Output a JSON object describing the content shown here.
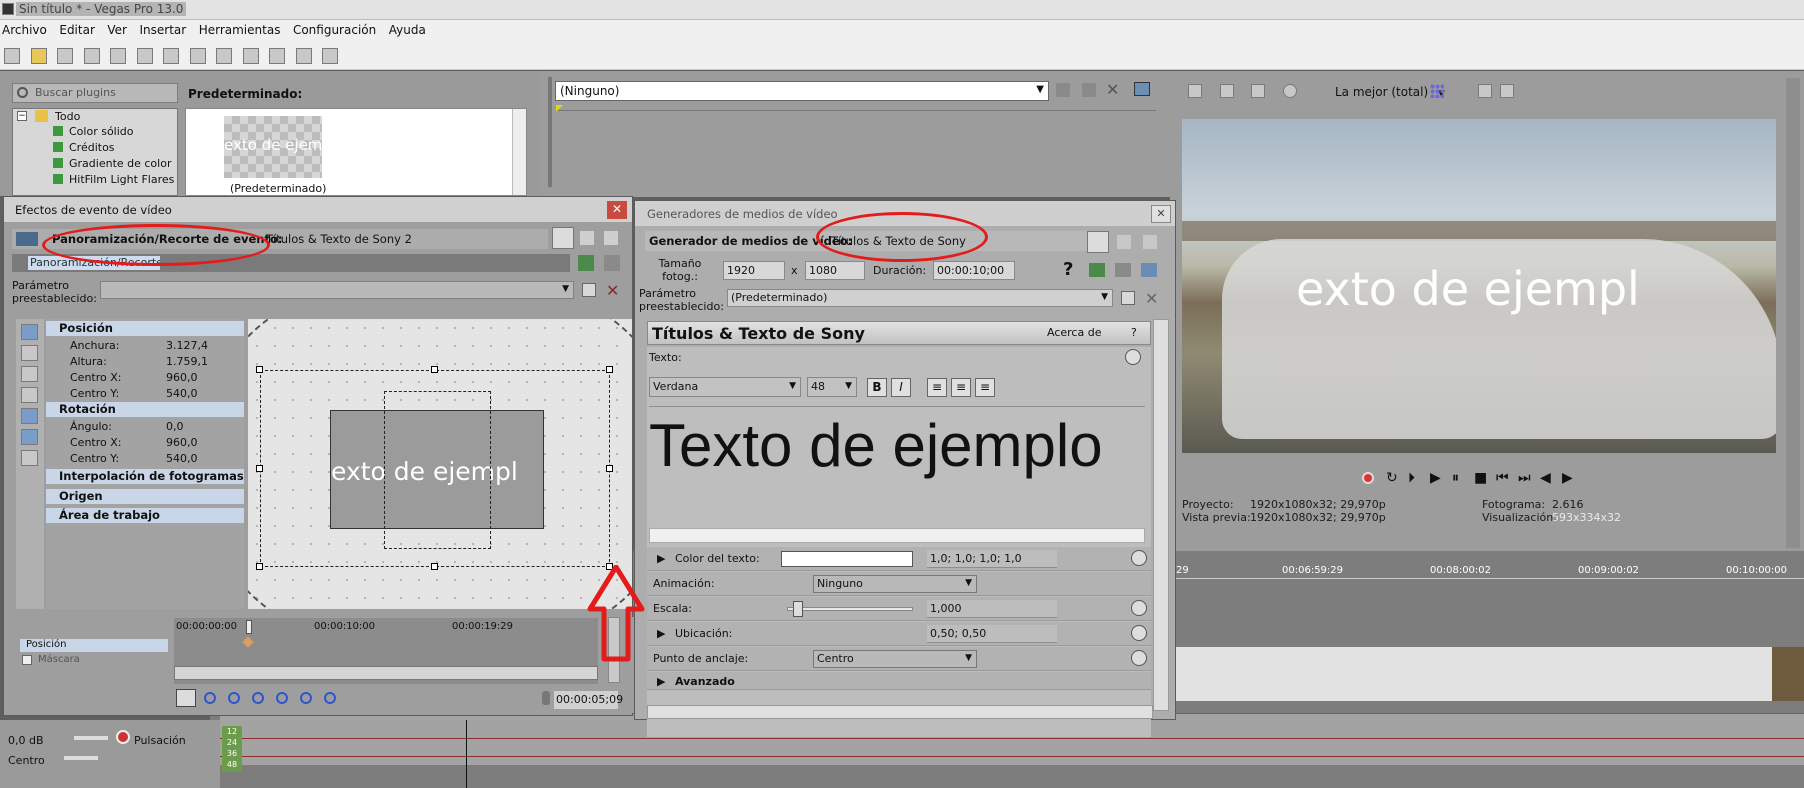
{
  "window": {
    "title": "Sin título * - Vegas Pro 13.0"
  },
  "menu": [
    "Archivo",
    "Editar",
    "Ver",
    "Insertar",
    "Herramientas",
    "Configuración",
    "Ayuda"
  ],
  "plugins": {
    "search_placeholder": "Buscar plugins",
    "tree": [
      "Todo",
      "Color sólido",
      "Créditos",
      "Gradiente de color",
      "HitFilm Light Flares"
    ],
    "preset_label": "Predeterminado:",
    "thumb_text": "exto de ejemp",
    "thumb_caption": "(Predeterminado)"
  },
  "midtop": {
    "dropdown_value": "(Ninguno)"
  },
  "preview": {
    "quality": "La mejor (total)",
    "overlay_text": "exto de ejempl",
    "info": {
      "proyecto_label": "Proyecto:",
      "proyecto_value": "1920x1080x32; 29,970p",
      "vista_label": "Vista previa:",
      "vista_value": "1920x1080x32; 29,970p",
      "fotograma_label": "Fotograma:",
      "fotograma_value": "2.616",
      "visual_label": "Visualización:",
      "visual_value": "593x334x32"
    }
  },
  "timeline": {
    "ruler": [
      "29",
      "00:06:59:29",
      "00:08:00:02",
      "00:09:00:02",
      "00:10:00:00"
    ],
    "track": {
      "volume": "0,0 dB",
      "pan_mode": "Pulsación",
      "pan": "Centro",
      "meter": [
        "12",
        "24",
        "36",
        "48"
      ]
    }
  },
  "win1": {
    "title": "Efectos de evento de vídeo",
    "header_label": "Panoramización/Recorte de evento:",
    "header_value": "Títulos & Texto de Sony 2",
    "tab": "Panoramización/Recorte",
    "param_label": "Parámetro preestablecido:",
    "sections": {
      "posicion": "Posición",
      "rotacion": "Rotación",
      "interpolacion": "Interpolación de fotogramas c...",
      "origen": "Origen",
      "area": "Área de trabajo"
    },
    "props": {
      "anchura_l": "Anchura:",
      "anchura_v": "3.127,4",
      "altura_l": "Altura:",
      "altura_v": "1.759,1",
      "cx_l": "Centro X:",
      "cx_v": "960,0",
      "cy_l": "Centro Y:",
      "cy_v": "540,0",
      "angulo_l": "Ángulo:",
      "angulo_v": "0,0",
      "rcx_l": "Centro X:",
      "rcx_v": "960,0",
      "rcy_l": "Centro Y:",
      "rcy_v": "540,0"
    },
    "canvas_text": "exto de ejempl",
    "kf_rows": [
      "Posición",
      "Máscara"
    ],
    "kf_ticks": [
      "00:00:00:00",
      "00:00:10:00",
      "00:00:19:29"
    ],
    "timecode": "00:00:05;09"
  },
  "win2": {
    "title": "Generadores de medios de vídeo",
    "gen_label": "Generador de medios de vídeo:",
    "gen_value": "Títulos & Texto de Sony",
    "size_label": "Tamaño fotog.:",
    "width": "1920",
    "x": "x",
    "height": "1080",
    "duracion_label": "Duración:",
    "duracion_value": "00:00:10;00",
    "param_label": "Parámetro preestablecido:",
    "param_value": "(Predeterminado)",
    "plugin_title": "Títulos & Texto de Sony",
    "about": "Acerca de",
    "help": "?",
    "texto_label": "Texto:",
    "font": "Verdana",
    "size": "48",
    "sample": "Texto de ejemplo",
    "rows": {
      "color_l": "Color del texto:",
      "color_v": "1,0; 1,0; 1,0; 1,0",
      "anim_l": "Animación:",
      "anim_v": "Ninguno",
      "escala_l": "Escala:",
      "escala_v": "1,000",
      "ubic_l": "Ubicación:",
      "ubic_v": "0,50; 0,50",
      "punto_l": "Punto de anclaje:",
      "punto_v": "Centro",
      "avanzado": "Avanzado"
    }
  },
  "colors": {
    "annotation": "#e41b1b",
    "selection": "#cfdcf0"
  }
}
